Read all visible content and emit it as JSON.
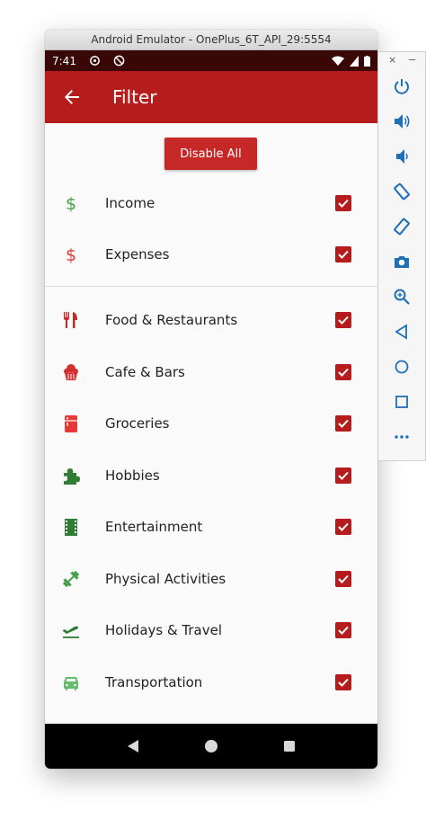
{
  "window": {
    "title": "Android Emulator - OnePlus_6T_API_29:5554"
  },
  "status_bar": {
    "time": "7:41"
  },
  "app_bar": {
    "title": "Filter",
    "back_icon": "arrow-back-icon"
  },
  "actions": {
    "disable_all_label": "Disable All"
  },
  "colors": {
    "primary": "#b71c1c",
    "income": "#43a047",
    "expense": "#e53935",
    "dark_green": "#2e7d32"
  },
  "groups": {
    "types": [
      {
        "label": "Income",
        "icon": "dollar-icon",
        "checked": true
      },
      {
        "label": "Expenses",
        "icon": "dollar-icon",
        "checked": true
      }
    ],
    "categories": [
      {
        "label": "Food & Restaurants",
        "icon": "restaurant-icon",
        "checked": true
      },
      {
        "label": "Cafe & Bars",
        "icon": "cake-icon",
        "checked": true
      },
      {
        "label": "Groceries",
        "icon": "fridge-icon",
        "checked": true
      },
      {
        "label": "Hobbies",
        "icon": "puzzle-icon",
        "checked": true
      },
      {
        "label": "Entertainment",
        "icon": "film-icon",
        "checked": true
      },
      {
        "label": "Physical Activities",
        "icon": "fitness-icon",
        "checked": true
      },
      {
        "label": "Holidays & Travel",
        "icon": "flight-takeoff-icon",
        "checked": true
      },
      {
        "label": "Transportation",
        "icon": "car-icon",
        "checked": true
      }
    ]
  },
  "emulator_controls": {
    "close": "×",
    "minimize": "−",
    "buttons": [
      "power-icon",
      "volume-up-icon",
      "volume-down-icon",
      "rotate-left-icon",
      "rotate-right-icon",
      "camera-icon",
      "zoom-icon",
      "back-icon",
      "home-icon",
      "overview-icon",
      "more-icon"
    ]
  }
}
